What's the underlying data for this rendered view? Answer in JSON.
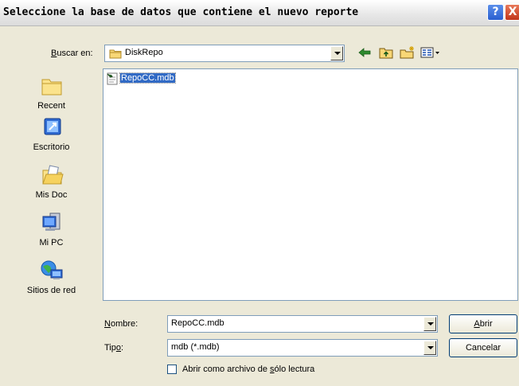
{
  "window": {
    "title": "Seleccione la base de datos que contiene el nuevo reporte"
  },
  "title_buttons": {
    "help": "?",
    "close": "X"
  },
  "lookin": {
    "label_pre": "",
    "label_u": "B",
    "label_post": "uscar en:",
    "value": "DiskRepo"
  },
  "toolbar": {
    "back_icon": "back-arrow-icon",
    "up_icon": "up-folder-icon",
    "newfolder_icon": "new-folder-icon",
    "views_icon": "views-menu-icon"
  },
  "places": [
    {
      "label": "Recent",
      "icon": "recent-folder-icon"
    },
    {
      "label": "Escritorio",
      "icon": "desktop-icon"
    },
    {
      "label": "Mis Doc",
      "icon": "my-documents-icon"
    },
    {
      "label": "Mi PC",
      "icon": "my-computer-icon"
    },
    {
      "label": "Sitios de red",
      "icon": "network-places-icon"
    }
  ],
  "files": [
    {
      "name": "RepoCC.mdb",
      "selected": true
    }
  ],
  "filename": {
    "label_u": "N",
    "label_rest": "ombre:",
    "value": "RepoCC.mdb"
  },
  "filetype": {
    "label_pre": "Tip",
    "label_u": "o",
    "label_post": ":",
    "value": "mdb (*.mdb)"
  },
  "readonly": {
    "label_pre": "Abrir como archivo de ",
    "label_u": "s",
    "label_post": "ólo lectura",
    "checked": false
  },
  "buttons": {
    "open_u": "A",
    "open_rest": "brir",
    "cancel": "Cancelar"
  }
}
